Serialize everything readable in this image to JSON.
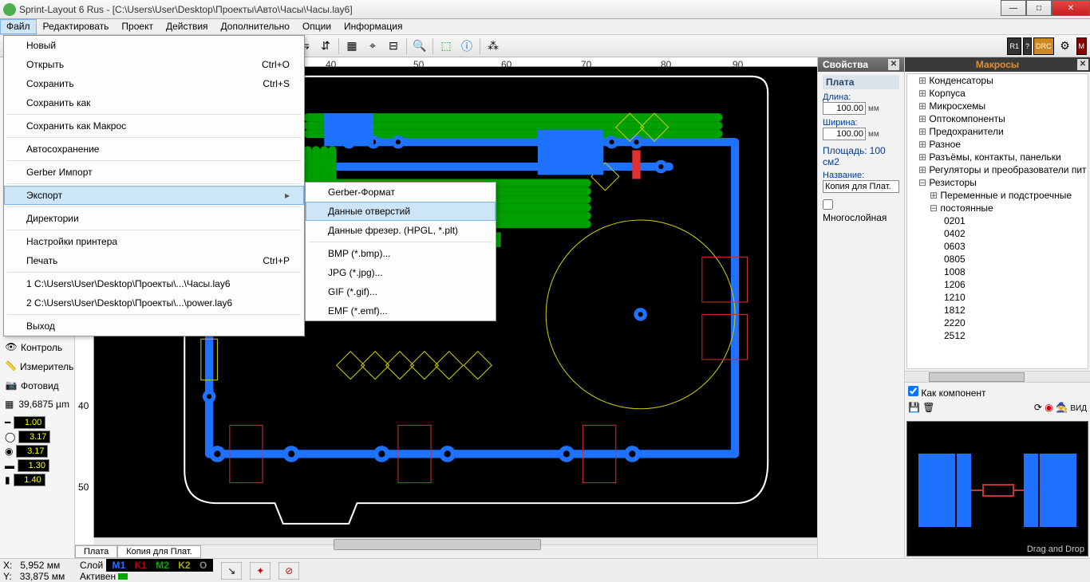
{
  "window": {
    "title": "Sprint-Layout 6 Rus - [C:\\Users\\User\\Desktop\\Проекты\\Авто\\Часы\\Часы.lay6]"
  },
  "menubar": [
    "Файл",
    "Редактировать",
    "Проект",
    "Действия",
    "Дополнительно",
    "Опции",
    "Информация"
  ],
  "file_menu": {
    "items": [
      {
        "label": "Новый"
      },
      {
        "label": "Открыть",
        "accel": "Ctrl+O"
      },
      {
        "label": "Сохранить",
        "accel": "Ctrl+S"
      },
      {
        "label": "Сохранить как"
      },
      {
        "sep": true
      },
      {
        "label": "Сохранить как Макрос"
      },
      {
        "sep": true
      },
      {
        "label": "Автосохранение"
      },
      {
        "sep": true
      },
      {
        "label": "Gerber Импорт"
      },
      {
        "sep": true
      },
      {
        "label": "Экспорт",
        "sub": true,
        "selected": true
      },
      {
        "sep": true
      },
      {
        "label": "Директории"
      },
      {
        "sep": true
      },
      {
        "label": "Настройки принтера"
      },
      {
        "label": "Печать",
        "accel": "Ctrl+P"
      },
      {
        "sep": true
      },
      {
        "label": "1 C:\\Users\\User\\Desktop\\Проекты\\...\\Часы.lay6"
      },
      {
        "label": "2 C:\\Users\\User\\Desktop\\Проекты\\...\\power.lay6"
      },
      {
        "sep": true
      },
      {
        "label": "Выход"
      }
    ]
  },
  "export_menu": {
    "items": [
      {
        "label": "Gerber-Формат"
      },
      {
        "label": "Данные отверстий",
        "selected": true
      },
      {
        "label": "Данные фрезер. (HPGL, *.plt)"
      },
      {
        "sep": true
      },
      {
        "label": "BMP (*.bmp)..."
      },
      {
        "label": "JPG (*.jpg)..."
      },
      {
        "label": "GIF (*.gif)..."
      },
      {
        "label": "EMF (*.emf)..."
      }
    ]
  },
  "ruler_h": [
    "40",
    "50",
    "60",
    "70",
    "80",
    "90"
  ],
  "ruler_v": [
    "40",
    "50"
  ],
  "left_tools": {
    "control": "Контроль",
    "measure": "Измеритель",
    "photo": "Фотовид",
    "grid_value": "39,6875 µm",
    "v1": "1.00",
    "v2": "3.17",
    "v3": "3.17",
    "v4": "1.30",
    "v5": "1.40"
  },
  "tabs": [
    "Плата",
    "Копия для Плат."
  ],
  "props": {
    "title": "Свойства",
    "section": "Плата",
    "width_label": "Длина:",
    "width_val": "100.00",
    "height_label": "Ширина:",
    "height_val": "100.00",
    "unit": "мм",
    "area_label": "Площадь:",
    "area_val": "100 см2",
    "name_label": "Название:",
    "name_val": "Копия для Плат.",
    "multi": "Многослойная"
  },
  "macros": {
    "title": "Макросы",
    "nodes": [
      {
        "l": "Конденсаторы",
        "lvl": 0
      },
      {
        "l": "Корпуса",
        "lvl": 0
      },
      {
        "l": "Микросхемы",
        "lvl": 0
      },
      {
        "l": "Оптокомпоненты",
        "lvl": 0
      },
      {
        "l": "Предохранители",
        "lvl": 0
      },
      {
        "l": "Разное",
        "lvl": 0
      },
      {
        "l": "Разъёмы, контакты, панельки",
        "lvl": 0
      },
      {
        "l": "Регуляторы и преобразователи пит",
        "lvl": 0
      },
      {
        "l": "Резисторы",
        "lvl": 0,
        "open": true
      },
      {
        "l": "Переменные и подстроечные",
        "lvl": 1
      },
      {
        "l": "постоянные",
        "lvl": 1,
        "open": true
      },
      {
        "l": "0201",
        "lvl": 2,
        "leaf": true
      },
      {
        "l": "0402",
        "lvl": 2,
        "leaf": true
      },
      {
        "l": "0603",
        "lvl": 2,
        "leaf": true
      },
      {
        "l": "0805",
        "lvl": 2,
        "leaf": true
      },
      {
        "l": "1008",
        "lvl": 2,
        "leaf": true
      },
      {
        "l": "1206",
        "lvl": 2,
        "leaf": true
      },
      {
        "l": "1210",
        "lvl": 2,
        "leaf": true
      },
      {
        "l": "1812",
        "lvl": 2,
        "leaf": true
      },
      {
        "l": "2220",
        "lvl": 2,
        "leaf": true
      },
      {
        "l": "2512",
        "lvl": 2,
        "leaf": true
      }
    ],
    "as_component": "Как компонент",
    "dnd": "Drag and Drop",
    "wiz_label": "ВИД"
  },
  "status": {
    "x_label": "X:",
    "x": "5,952 мм",
    "y_label": "Y:",
    "y": "33,875 мм",
    "layer_label": "Слой",
    "active_label": "Активен",
    "layers": [
      "M1",
      "K1",
      "M2",
      "K2",
      "О"
    ]
  },
  "toolbar_right": [
    "R1",
    "?",
    "DRC",
    "M"
  ]
}
